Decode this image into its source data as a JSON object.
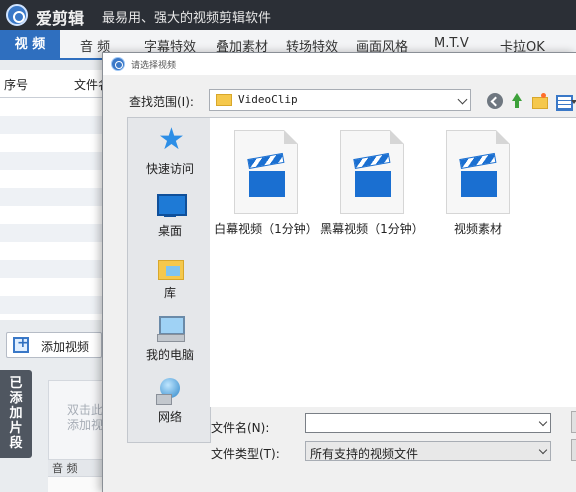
{
  "app": {
    "name": "爱剪辑",
    "slogan": "最易用、强大的视频剪辑软件"
  },
  "tabs": [
    "视 频",
    "音 频",
    "字幕特效",
    "叠加素材",
    "转场特效",
    "画面风格",
    "M.T.V",
    "卡拉OK"
  ],
  "table": {
    "columns": [
      "序号",
      "文件名"
    ]
  },
  "left_panel": {
    "add_video_label": "添加视频",
    "added_clips_tab": [
      "已",
      "添",
      "加",
      "片",
      "段"
    ],
    "drop_hint_line1": "双击此",
    "drop_hint_line2": "添加视",
    "audio_label": "音 频"
  },
  "dialog": {
    "title": "请选择视频",
    "look_in_label": "查找范围(I):",
    "look_in_value": "VideoClip",
    "places": [
      "快速访问",
      "桌面",
      "库",
      "我的电脑",
      "网络"
    ],
    "files": [
      {
        "name": "白幕视频（1分钟）"
      },
      {
        "name": "黑幕视频（1分钟）"
      },
      {
        "name": "视频素材"
      }
    ],
    "filename_label": "文件名(N):",
    "filename_value": "",
    "filetype_label": "文件类型(T):",
    "filetype_value": "所有支持的视频文件"
  }
}
